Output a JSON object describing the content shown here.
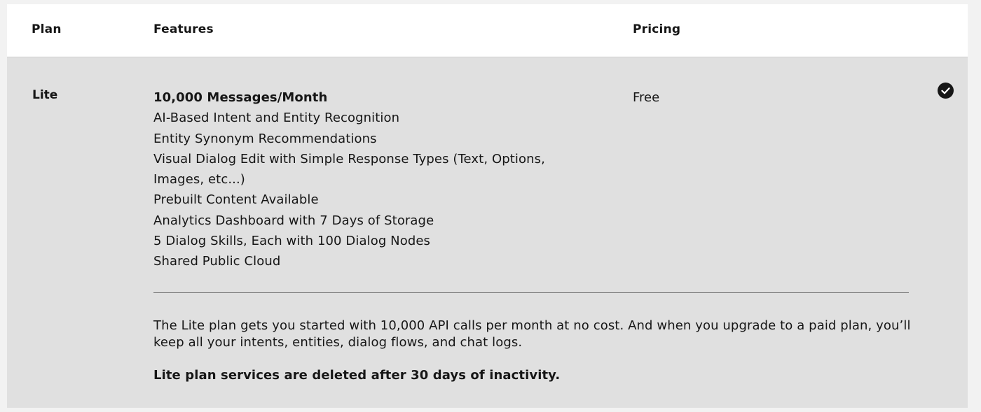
{
  "header": {
    "plan": "Plan",
    "features": "Features",
    "pricing": "Pricing"
  },
  "plan": {
    "name": "Lite",
    "features": [
      "10,000 Messages/Month",
      "AI-Based Intent and Entity Recognition",
      "Entity Synonym Recommendations",
      "Visual Dialog Edit with Simple Response Types (Text, Options,",
      "Images, etc...)",
      "Prebuilt Content Available",
      "Analytics Dashboard with 7 Days of Storage",
      "5 Dialog Skills, Each with 100 Dialog Nodes",
      "Shared Public Cloud"
    ],
    "price": "Free",
    "selected": true,
    "selected_icon": "checkmark-filled-icon",
    "description": "The Lite plan gets you started with 10,000 API calls per month at no cost. And when you upgrade to a paid plan, you’ll keep all your intents, entities, dialog flows, and chat logs.",
    "note": "Lite plan services are deleted after 30 days of inactivity."
  },
  "colors": {
    "row_background": "#e0e0e0",
    "header_background": "#ffffff",
    "text": "#161616"
  }
}
